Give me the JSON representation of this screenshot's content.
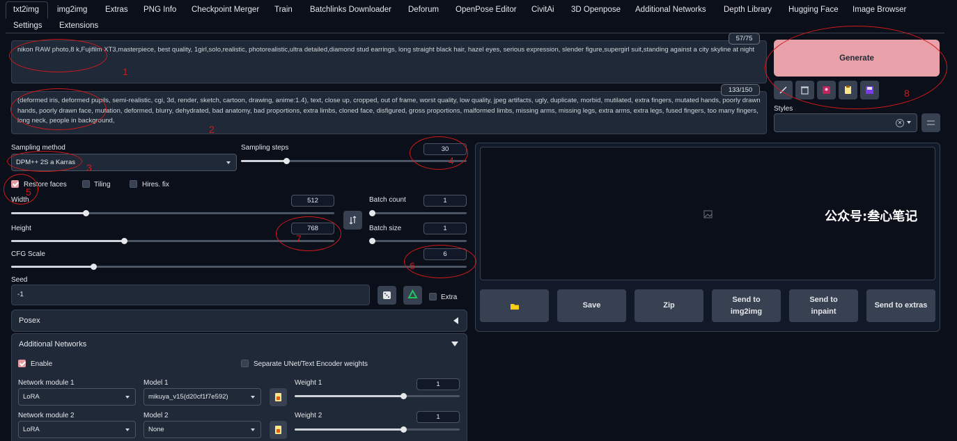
{
  "tabs": [
    "txt2img",
    "img2img",
    "Extras",
    "PNG Info",
    "Checkpoint Merger",
    "Train",
    "Batchlinks Downloader",
    "Deforum",
    "OpenPose Editor",
    "CivitAi",
    "3D Openpose",
    "Additional Networks",
    "Depth Library",
    "Hugging Face",
    "Image Browser",
    "Settings",
    "Extensions"
  ],
  "prompt": {
    "positive": "nikon RAW photo,8 k,Fujifilm XT3,masterpiece, best quality, 1girl,solo,realistic, photorealistic,ultra detailed,diamond stud earrings, long straight black hair, hazel eyes, serious expression, slender figure,supergirl suit,standing against a city skyline at night",
    "positive_count": "57/75",
    "negative": "(deformed iris, deformed pupils, semi-realistic, cgi, 3d, render, sketch, cartoon, drawing, anime:1.4), text, close up, cropped, out of frame, worst quality, low quality, jpeg artifacts, ugly, duplicate, morbid, mutilated, extra fingers, mutated hands, poorly drawn hands, poorly drawn face, mutation, deformed, blurry, dehydrated, bad anatomy, bad proportions, extra limbs, cloned face, disfigured, gross proportions, malformed limbs, missing arms, missing legs, extra arms, extra legs, fused fingers, too many fingers, long neck, people in background,",
    "negative_count": "133/150"
  },
  "generate": {
    "label": "Generate",
    "styles_label": "Styles",
    "color": "#e8a1a9"
  },
  "toolbar_icons": [
    "pen-icon",
    "trash-icon",
    "picture-card-icon",
    "clipboard-icon",
    "floppy-disk-icon"
  ],
  "sampling": {
    "method_label": "Sampling method",
    "method_value": "DPM++ 2S a Karras",
    "steps_label": "Sampling steps",
    "steps_value": "30",
    "steps_frac": 0.2
  },
  "checks": {
    "restore_faces": "Restore faces",
    "tiling": "Tiling",
    "hires": "Hires. fix"
  },
  "size": {
    "width_label": "Width",
    "width_value": "512",
    "width_frac": 0.23,
    "height_label": "Height",
    "height_value": "768",
    "height_frac": 0.35
  },
  "batch": {
    "count_label": "Batch count",
    "count_value": "1",
    "size_label": "Batch size",
    "size_value": "1"
  },
  "cfg": {
    "label": "CFG Scale",
    "value": "6",
    "frac": 0.18
  },
  "seed": {
    "label": "Seed",
    "value": "-1",
    "extra_label": "Extra"
  },
  "posex": {
    "label": "Posex"
  },
  "additional_networks": {
    "title": "Additional Networks",
    "enable": "Enable",
    "separate": "Separate UNet/Text Encoder weights",
    "rows": [
      {
        "module_label": "Network module 1",
        "module": "LoRA",
        "model_label": "Model 1",
        "model": "mikuya_v15(d20cf1f7e592)",
        "weight_label": "Weight 1",
        "weight": "1",
        "weight_frac": 0.66
      },
      {
        "module_label": "Network module 2",
        "module": "LoRA",
        "model_label": "Model 2",
        "model": "None",
        "weight_label": "Weight 2",
        "weight": "1",
        "weight_frac": 0.66
      }
    ]
  },
  "output_buttons": {
    "folder_icon": "folder-icon",
    "save": "Save",
    "zip": "Zip",
    "send_img2img": "Send to img2img",
    "send_inpaint": "Send to inpaint",
    "send_extras": "Send to extras"
  },
  "watermark": "公众号:叁心笔记",
  "annotations": [
    "1",
    "2",
    "3",
    "4",
    "5",
    "6",
    "7",
    "8"
  ]
}
